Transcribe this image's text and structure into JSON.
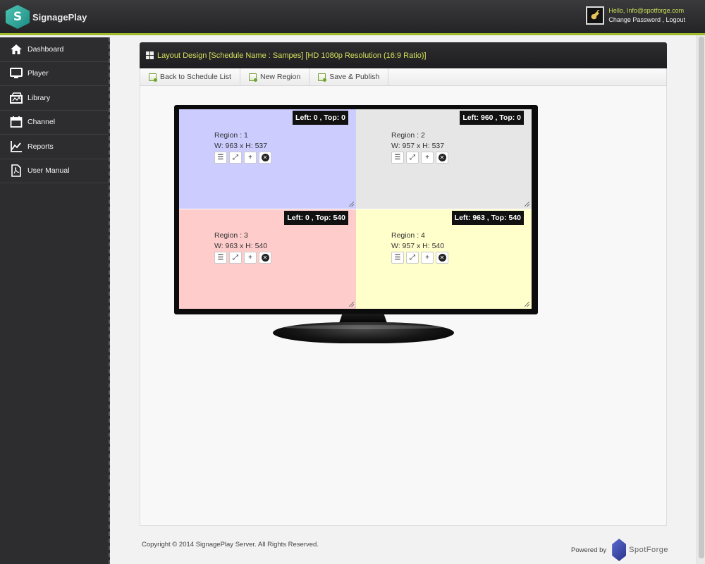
{
  "app": {
    "name": "SignagePlay",
    "logo_glyph": "S"
  },
  "user": {
    "greeting": "Hello, Info@spotforge.com",
    "change_password": "Change Password",
    "separator": " , ",
    "logout": "Logout"
  },
  "sidebar": {
    "items": [
      {
        "label": "Dashboard",
        "icon": "home-icon"
      },
      {
        "label": "Player",
        "icon": "monitor-icon"
      },
      {
        "label": "Library",
        "icon": "library-icon"
      },
      {
        "label": "Channel",
        "icon": "calendar-icon"
      },
      {
        "label": "Reports",
        "icon": "chart-icon"
      },
      {
        "label": "User Manual",
        "icon": "pdf-icon"
      }
    ]
  },
  "panel": {
    "title": "Layout Design [Schedule Name : Sampes] [HD 1080p Resolution (16:9 Ratio)]"
  },
  "toolbar": {
    "back_label": "Back to Schedule List",
    "new_region_label": "New Region",
    "save_publish_label": "Save & Publish"
  },
  "regions": [
    {
      "position": "Left: 0 , Top: 0",
      "name": "Region : 1",
      "size": "W: 963 x H: 537",
      "color": "#ccccff"
    },
    {
      "position": "Left: 960 , Top: 0",
      "name": "Region : 2",
      "size": "W: 957 x H: 537",
      "color": "#e6e6e6"
    },
    {
      "position": "Left: 0 , Top: 540",
      "name": "Region : 3",
      "size": "W: 963 x H: 540",
      "color": "#ffcccc"
    },
    {
      "position": "Left: 963 , Top: 540",
      "name": "Region : 4",
      "size": "W: 957 x H: 540",
      "color": "#ffffcc"
    }
  ],
  "region_tools": {
    "list_glyph": "☰",
    "expand_glyph": "⤢",
    "add_glyph": "+",
    "remove_glyph": "✕"
  },
  "footer": {
    "copyright": "Copyright © 2014 SignagePlay Server. All Rights Reserved.",
    "powered_by": "Powered by",
    "brand": "SpotForge"
  },
  "colors": {
    "accent": "#9dbb2b",
    "title_text": "#d4e15c",
    "header_bg": "#2e2e30"
  }
}
